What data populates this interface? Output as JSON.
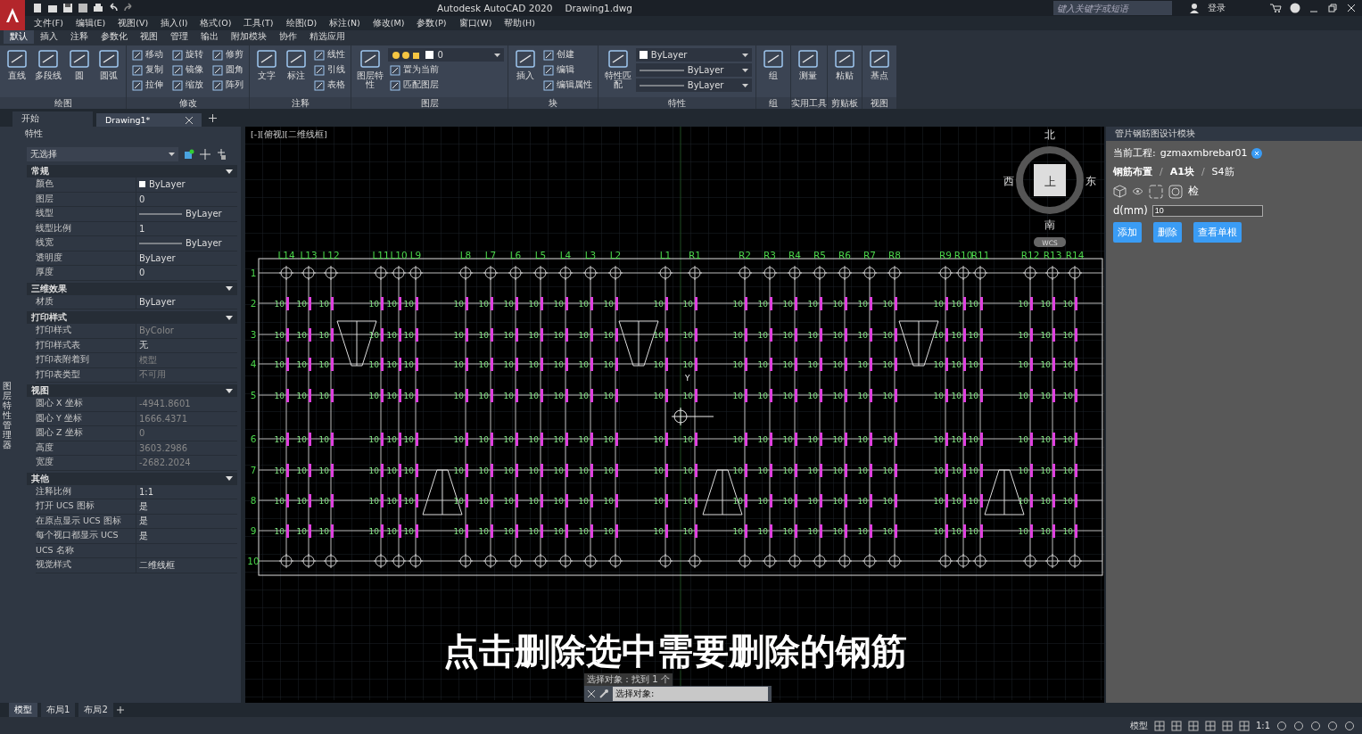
{
  "title_bar": {
    "title": "Autodesk AutoCAD 2020",
    "file": "Drawing1.dwg",
    "search": {
      "placeholder": "键入关键字或短语"
    },
    "login": "登录"
  },
  "menu": [
    "文件(F)",
    "编辑(E)",
    "视图(V)",
    "插入(I)",
    "格式(O)",
    "工具(T)",
    "绘图(D)",
    "标注(N)",
    "修改(M)",
    "参数(P)",
    "窗口(W)",
    "帮助(H)"
  ],
  "ribbon_tabs": [
    {
      "label": "默认",
      "selected": true
    },
    {
      "label": "插入",
      "selected": false
    },
    {
      "label": "注释",
      "selected": false
    },
    {
      "label": "参数化",
      "selected": false
    },
    {
      "label": "视图",
      "selected": false
    },
    {
      "label": "管理",
      "selected": false
    },
    {
      "label": "输出",
      "selected": false
    },
    {
      "label": "附加模块",
      "selected": false
    },
    {
      "label": "协作",
      "selected": false
    },
    {
      "label": "精选应用",
      "selected": false
    }
  ],
  "ribbon_panels": [
    {
      "title": "绘图",
      "large": [
        "直线",
        "多段线",
        "圆",
        "圆弧"
      ]
    },
    {
      "title": "修改",
      "small": [
        "移动",
        "复制",
        "拉伸",
        "旋转",
        "镜像",
        "缩放",
        "修剪",
        "圆角",
        "阵列"
      ]
    },
    {
      "title": "注释",
      "large": [
        "文字",
        "标注"
      ],
      "small": [
        "线性",
        "引线",
        "表格"
      ]
    },
    {
      "title": "图层",
      "large": [
        "图层特性"
      ],
      "dropdowns": [
        {
          "kind": "layer",
          "value": "0"
        }
      ],
      "small": [
        "置为当前",
        "匹配图层"
      ]
    },
    {
      "title": "块",
      "large": [
        "插入"
      ],
      "small": [
        "创建",
        "编辑",
        "编辑属性"
      ]
    },
    {
      "title": "特性",
      "large": [
        "特性匹配"
      ],
      "dropdowns": [
        {
          "kind": "color",
          "value": "ByLayer"
        },
        {
          "kind": "line",
          "value": "ByLayer"
        },
        {
          "kind": "line",
          "value": "ByLayer"
        }
      ]
    },
    {
      "title": "组",
      "large": [
        "组"
      ]
    },
    {
      "title": "实用工具",
      "large": [
        "测量"
      ]
    },
    {
      "title": "剪贴板",
      "large": [
        "粘贴"
      ]
    },
    {
      "title": "视图",
      "large": [
        "基点"
      ]
    }
  ],
  "file_tabs": [
    {
      "label": "开始",
      "selected": false,
      "closable": false
    },
    {
      "label": "Drawing1*",
      "selected": true,
      "closable": true
    }
  ],
  "side_strip": {
    "label": "图层特性管理器"
  },
  "properties": {
    "title": "特性",
    "selector": "无选择",
    "sections": [
      {
        "title": "常规",
        "expanded": true,
        "rows": [
          {
            "label": "颜色",
            "value": "ByLayer",
            "kind": "color",
            "disabled": false
          },
          {
            "label": "图层",
            "value": "0",
            "kind": "text",
            "disabled": false
          },
          {
            "label": "线型",
            "value": "ByLayer",
            "kind": "line",
            "disabled": false
          },
          {
            "label": "线型比例",
            "value": "1",
            "kind": "text",
            "disabled": false
          },
          {
            "label": "线宽",
            "value": "ByLayer",
            "kind": "line",
            "disabled": false
          },
          {
            "label": "透明度",
            "value": "ByLayer",
            "kind": "text",
            "disabled": false
          },
          {
            "label": "厚度",
            "value": "0",
            "kind": "text",
            "disabled": false
          }
        ]
      },
      {
        "title": "三维效果",
        "expanded": true,
        "rows": [
          {
            "label": "材质",
            "value": "ByLayer",
            "kind": "text",
            "disabled": false
          }
        ]
      },
      {
        "title": "打印样式",
        "expanded": true,
        "rows": [
          {
            "label": "打印样式",
            "value": "ByColor",
            "kind": "text",
            "disabled": true
          },
          {
            "label": "打印样式表",
            "value": "无",
            "kind": "text",
            "disabled": false
          },
          {
            "label": "打印表附着到",
            "value": "模型",
            "kind": "text",
            "disabled": true
          },
          {
            "label": "打印表类型",
            "value": "不可用",
            "kind": "text",
            "disabled": true
          }
        ]
      },
      {
        "title": "视图",
        "expanded": true,
        "rows": [
          {
            "label": "圆心 X 坐标",
            "value": "-4941.8601",
            "kind": "text",
            "disabled": true
          },
          {
            "label": "圆心 Y 坐标",
            "value": "1666.4371",
            "kind": "text",
            "disabled": true
          },
          {
            "label": "圆心 Z 坐标",
            "value": "0",
            "kind": "text",
            "disabled": true
          },
          {
            "label": "高度",
            "value": "3603.2986",
            "kind": "text",
            "disabled": true
          },
          {
            "label": "宽度",
            "value": "-2682.2024",
            "kind": "text",
            "disabled": true
          }
        ]
      },
      {
        "title": "其他",
        "expanded": true,
        "rows": [
          {
            "label": "注释比例",
            "value": "1:1",
            "kind": "text",
            "disabled": false
          },
          {
            "label": "打开 UCS 图标",
            "value": "是",
            "kind": "text",
            "disabled": false
          },
          {
            "label": "在原点显示 UCS 图标",
            "value": "是",
            "kind": "text",
            "disabled": false
          },
          {
            "label": "每个视口都显示 UCS",
            "value": "是",
            "kind": "text",
            "disabled": false
          },
          {
            "label": "UCS 名称",
            "kind": "text",
            "disabled": false
          },
          {
            "label": "视觉样式",
            "value": "二维线框",
            "kind": "text",
            "disabled": false
          }
        ]
      }
    ]
  },
  "drawing": {
    "view_label": "[-][俯视][二维线框]",
    "columns": [
      "L14",
      "L13",
      "L12",
      "L11",
      "L10",
      "L9",
      "L8",
      "L7",
      "L6",
      "L5",
      "L4",
      "L3",
      "L2",
      "L1",
      "R1",
      "R2",
      "R3",
      "R4",
      "R5",
      "R6",
      "R7",
      "R8",
      "R9",
      "R10",
      "R11",
      "R12",
      "R13",
      "R14"
    ],
    "rows": [
      {
        "label": "1"
      },
      {
        "label": "2",
        "bar_labels": [
          "10",
          "10",
          "10",
          "10",
          "10",
          "10",
          "10",
          "10",
          "10",
          "10",
          "10",
          "10",
          "10",
          "10",
          "10",
          "10",
          "10",
          "10",
          "10",
          "10",
          "10",
          "10",
          "10",
          "10",
          "10",
          "10",
          "10",
          "10"
        ]
      },
      {
        "label": "3",
        "bar_labels": [
          "10",
          "10",
          "10",
          "10",
          "10",
          "10",
          "10",
          "10",
          "10",
          "10",
          "10",
          "10",
          "10",
          "10",
          "10",
          "10",
          "10",
          "10",
          "10",
          "10",
          "10",
          "10",
          "10",
          "10",
          "10",
          "10",
          "10",
          "10"
        ]
      },
      {
        "label": "4",
        "bar_labels": [
          "10",
          "10",
          "10",
          "10",
          "10",
          "10",
          "10",
          "10",
          "10",
          "10",
          "10",
          "10",
          "10",
          "10",
          "10",
          "10",
          "10",
          "10",
          "10",
          "10",
          "10",
          "10",
          "10",
          "10",
          "10",
          "10",
          "10",
          "10"
        ]
      },
      {
        "label": "5",
        "bar_labels": [
          "10",
          "10",
          "10",
          "10",
          "10",
          "10",
          "10",
          "10",
          "10",
          "10",
          "10",
          "10",
          "10",
          "10",
          "10",
          "10",
          "10",
          "10",
          "10",
          "10",
          "10",
          "10",
          "10",
          "10",
          "10",
          "10",
          "10",
          "10"
        ]
      },
      {
        "label": "6",
        "bar_labels": [
          "10",
          "10",
          "10",
          "10",
          "10",
          "10",
          "10",
          "10",
          "10",
          "10",
          "10",
          "10",
          "10",
          "10",
          "10",
          "10",
          "10",
          "10",
          "10",
          "10",
          "10",
          "10",
          "10",
          "10",
          "10",
          "10",
          "10",
          "10"
        ]
      },
      {
        "label": "7",
        "bar_labels": [
          "10",
          "10",
          "10",
          "10",
          "10",
          "10",
          "10",
          "10",
          "10",
          "10",
          "10",
          "10",
          "10",
          "10",
          "10",
          "10",
          "10",
          "10",
          "10",
          "10",
          "10",
          "10",
          "10",
          "10",
          "10",
          "10",
          "10",
          "10"
        ]
      },
      {
        "label": "8",
        "bar_labels": [
          "10",
          "10",
          "10",
          "10",
          "10",
          "10",
          "10",
          "10",
          "10",
          "10",
          "10",
          "10",
          "10",
          "10",
          "10",
          "10",
          "10",
          "10",
          "10",
          "10",
          "10",
          "10",
          "10",
          "10",
          "10",
          "10",
          "10",
          "10"
        ]
      },
      {
        "label": "9",
        "bar_labels": [
          "10",
          "10",
          "10",
          "10",
          "10",
          "10",
          "10",
          "10",
          "10",
          "10",
          "10",
          "10",
          "10",
          "10",
          "10",
          "10",
          "10",
          "10",
          "10",
          "10",
          "10",
          "10",
          "10",
          "10",
          "10",
          "10",
          "10",
          "10"
        ]
      },
      {
        "label": "10"
      }
    ],
    "cursor_label": "Y",
    "viewcube": {
      "north": "北",
      "south": "南",
      "west": "西",
      "east": "东",
      "face": "上",
      "ucs": "WCS"
    },
    "subtitle": "点击删除选中需要删除的钢筋",
    "command": {
      "history": "选择对象：找到 1 个",
      "prompt": "选择对象:"
    }
  },
  "module_panel": {
    "title": "管片钢筋图设计模块",
    "project_label": "当前工程:",
    "project": "gzmaxmbrebar01",
    "breadcrumb": [
      {
        "label": "钢筋布置",
        "current": false,
        "separator": "/"
      },
      {
        "label": "A1块",
        "current": false,
        "separator": "/"
      },
      {
        "label": "S4筋",
        "current": true
      }
    ],
    "check_label": "检",
    "field": {
      "label": "d(mm)",
      "value": "10"
    },
    "buttons": [
      "添加",
      "删除",
      "查看单根"
    ]
  },
  "layout_tabs": [
    {
      "label": "模型",
      "selected": true
    },
    {
      "label": "布局1",
      "selected": false
    },
    {
      "label": "布局2",
      "selected": false
    }
  ],
  "status_bar": {
    "model": "模型",
    "scale": "1:1"
  }
}
